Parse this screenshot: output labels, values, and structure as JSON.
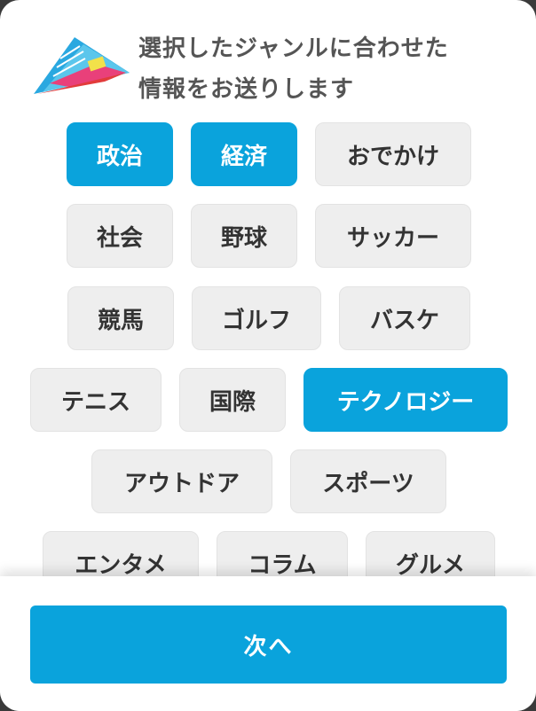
{
  "header": {
    "line1": "選択したジャンルに合わせた",
    "line2": "情報をお送りします",
    "logo_icon": "paper-plane-news-icon"
  },
  "colors": {
    "accent": "#0aa3dc",
    "chip_bg": "#eeeeee",
    "chip_text": "#333333"
  },
  "genres": [
    {
      "label": "政治",
      "selected": true
    },
    {
      "label": "経済",
      "selected": true
    },
    {
      "label": "おでかけ",
      "selected": false
    },
    {
      "label": "社会",
      "selected": false
    },
    {
      "label": "野球",
      "selected": false
    },
    {
      "label": "サッカー",
      "selected": false
    },
    {
      "label": "競馬",
      "selected": false
    },
    {
      "label": "ゴルフ",
      "selected": false
    },
    {
      "label": "バスケ",
      "selected": false
    },
    {
      "label": "テニス",
      "selected": false
    },
    {
      "label": "国際",
      "selected": false
    },
    {
      "label": "テクノロジー",
      "selected": true
    },
    {
      "label": "アウトドア",
      "selected": false
    },
    {
      "label": "スポーツ",
      "selected": false
    },
    {
      "label": "エンタメ",
      "selected": false
    },
    {
      "label": "コラム",
      "selected": false
    },
    {
      "label": "グルメ",
      "selected": false
    }
  ],
  "footer": {
    "next_label": "次へ"
  }
}
